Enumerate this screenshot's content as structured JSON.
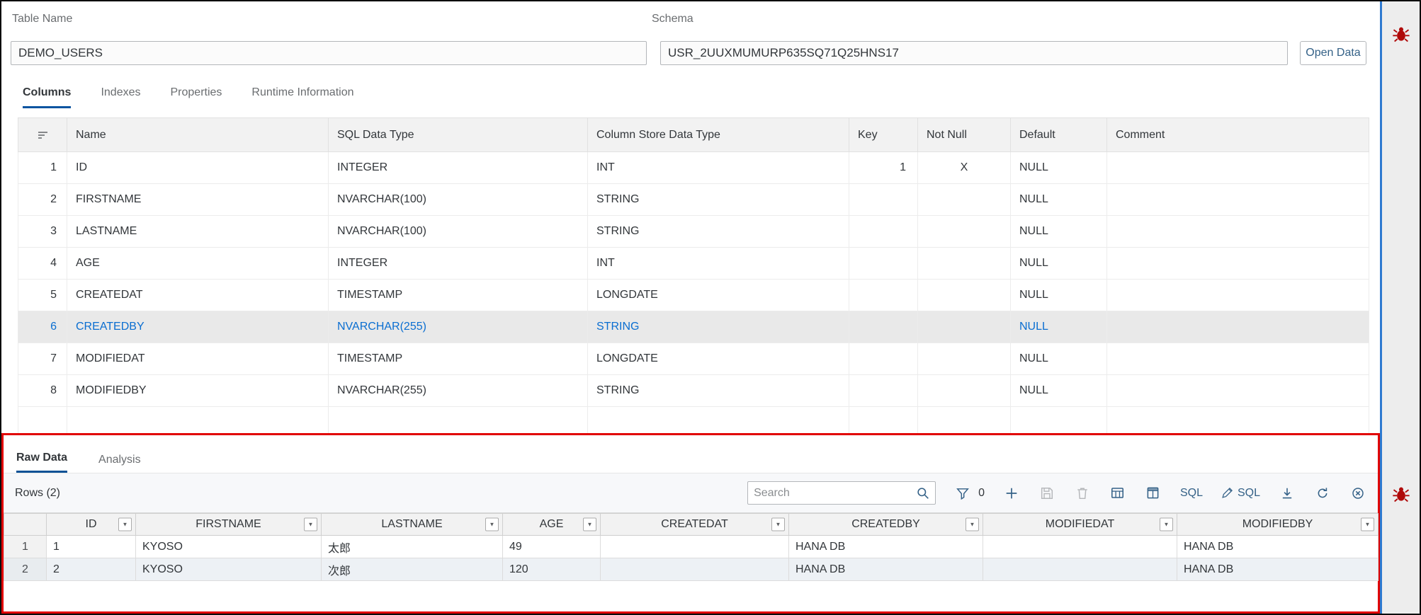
{
  "header": {
    "table_name_label": "Table Name",
    "table_name_value": "DEMO_USERS",
    "schema_label": "Schema",
    "schema_value": "USR_2UUXMUMURP635SQ71Q25HNS17",
    "open_data_button": "Open Data"
  },
  "tabs": [
    {
      "label": "Columns",
      "active": true
    },
    {
      "label": "Indexes",
      "active": false
    },
    {
      "label": "Properties",
      "active": false
    },
    {
      "label": "Runtime Information",
      "active": false
    }
  ],
  "columns_table": {
    "headers": [
      "Name",
      "SQL Data Type",
      "Column Store Data Type",
      "Key",
      "Not Null",
      "Default",
      "Comment"
    ],
    "rows": [
      {
        "num": "1",
        "name": "ID",
        "sql_data_type": "INTEGER",
        "column_store_data_type": "INT",
        "key": "1",
        "not_null": "X",
        "default": "NULL",
        "comment": "",
        "selected": false
      },
      {
        "num": "2",
        "name": "FIRSTNAME",
        "sql_data_type": "NVARCHAR(100)",
        "column_store_data_type": "STRING",
        "key": "",
        "not_null": "",
        "default": "NULL",
        "comment": "",
        "selected": false
      },
      {
        "num": "3",
        "name": "LASTNAME",
        "sql_data_type": "NVARCHAR(100)",
        "column_store_data_type": "STRING",
        "key": "",
        "not_null": "",
        "default": "NULL",
        "comment": "",
        "selected": false
      },
      {
        "num": "4",
        "name": "AGE",
        "sql_data_type": "INTEGER",
        "column_store_data_type": "INT",
        "key": "",
        "not_null": "",
        "default": "NULL",
        "comment": "",
        "selected": false
      },
      {
        "num": "5",
        "name": "CREATEDAT",
        "sql_data_type": "TIMESTAMP",
        "column_store_data_type": "LONGDATE",
        "key": "",
        "not_null": "",
        "default": "NULL",
        "comment": "",
        "selected": false
      },
      {
        "num": "6",
        "name": "CREATEDBY",
        "sql_data_type": "NVARCHAR(255)",
        "column_store_data_type": "STRING",
        "key": "",
        "not_null": "",
        "default": "NULL",
        "comment": "",
        "selected": true
      },
      {
        "num": "7",
        "name": "MODIFIEDAT",
        "sql_data_type": "TIMESTAMP",
        "column_store_data_type": "LONGDATE",
        "key": "",
        "not_null": "",
        "default": "NULL",
        "comment": "",
        "selected": false
      },
      {
        "num": "8",
        "name": "MODIFIEDBY",
        "sql_data_type": "NVARCHAR(255)",
        "column_store_data_type": "STRING",
        "key": "",
        "not_null": "",
        "default": "NULL",
        "comment": "",
        "selected": false
      }
    ]
  },
  "raw_data_panel": {
    "tabs": [
      {
        "label": "Raw Data",
        "active": true
      },
      {
        "label": "Analysis",
        "active": false
      }
    ],
    "rows_count_label": "Rows (2)",
    "toolbar": {
      "search_placeholder": "Search",
      "filter_count": "0",
      "sql_button_label": "SQL",
      "edit_sql_button_label": "SQL"
    },
    "grid": {
      "columns": [
        "ID",
        "FIRSTNAME",
        "LASTNAME",
        "AGE",
        "CREATEDAT",
        "CREATEDBY",
        "MODIFIEDAT",
        "MODIFIEDBY"
      ],
      "rows": [
        {
          "num": "1",
          "cells": [
            "1",
            "KYOSO",
            "太郎",
            "49",
            "",
            "HANA DB",
            "",
            "HANA DB"
          ]
        },
        {
          "num": "2",
          "cells": [
            "2",
            "KYOSO",
            "次郎",
            "120",
            "",
            "HANA DB",
            "",
            "HANA DB"
          ]
        }
      ]
    }
  },
  "annotations": {
    "highlight_border_color": "#e10000",
    "accent_blue": "#0854a0",
    "selected_text_blue": "#0a6ed1",
    "debug_icon_color": "#b00a0a"
  }
}
